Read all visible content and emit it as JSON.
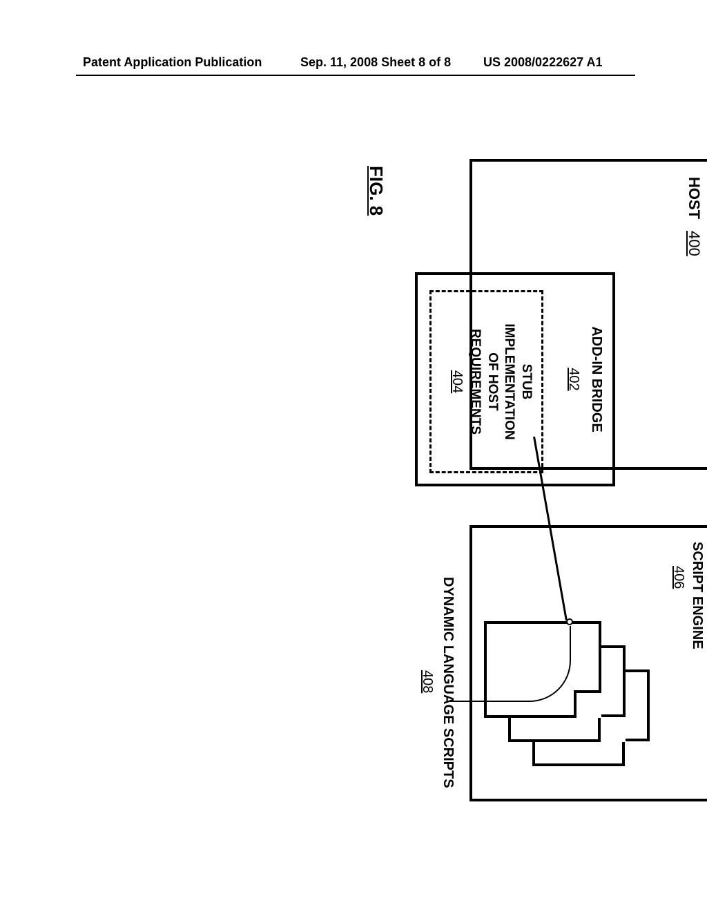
{
  "header": {
    "left": "Patent Application Publication",
    "center": "Sep. 11, 2008  Sheet 8 of 8",
    "right": "US 2008/0222627 A1"
  },
  "diagram": {
    "host": {
      "label": "HOST",
      "ref": "400"
    },
    "addin": {
      "label": "ADD-IN BRIDGE",
      "ref": "402"
    },
    "stub": {
      "line1": "STUB",
      "line2": "IMPLEMENTATION",
      "line3": "OF HOST",
      "line4": "REQUIREMENTS",
      "ref": "404"
    },
    "engine": {
      "label": "SCRIPT ENGINE",
      "ref": "406"
    },
    "scripts": {
      "label": "DYNAMIC LANGUAGE SCRIPTS",
      "ref": "408"
    },
    "figure": "FIG. 8"
  },
  "chart_data": {
    "type": "diagram",
    "title": "FIG. 8",
    "components": [
      {
        "id": "400",
        "name": "HOST",
        "contains": [
          "402"
        ]
      },
      {
        "id": "402",
        "name": "ADD-IN BRIDGE",
        "contains": [
          "404"
        ]
      },
      {
        "id": "404",
        "name": "STUB IMPLEMENTATION OF HOST REQUIREMENTS",
        "style": "dashed"
      },
      {
        "id": "406",
        "name": "SCRIPT ENGINE",
        "contains": [
          "408"
        ]
      },
      {
        "id": "408",
        "name": "DYNAMIC LANGUAGE SCRIPTS",
        "icon": "document-stack",
        "count": 3
      }
    ],
    "connections": [
      {
        "from": "404",
        "to": "408"
      }
    ]
  }
}
